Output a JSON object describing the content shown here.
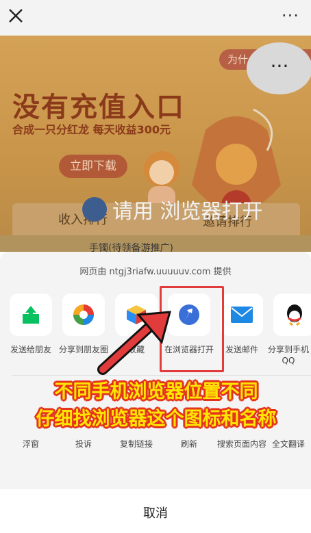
{
  "top_bar": {
    "close_icon": "close-icon",
    "more_icon": "more-icon",
    "more_glyph": "···"
  },
  "background_page": {
    "why_button": "为什么",
    "bubble_dots": "···",
    "title": "没有充值入口",
    "subtitle": "合成一只分红龙 每天收益300元",
    "download_button": "立即下载",
    "open_hint": "请用 浏览器打开",
    "tabs": [
      "收入排行",
      "邀请排行"
    ],
    "row_text": "手镯(待领备游推广)"
  },
  "share_sheet": {
    "provided_by": "网页由 ntgj3riafw.uuuuuv.com 提供",
    "row1": [
      {
        "label": "发送给朋友",
        "icon": "share-arrow-icon",
        "color": "#07c160"
      },
      {
        "label": "分享到朋友圈",
        "icon": "moments-icon",
        "color": "#f5a623"
      },
      {
        "label": "收藏",
        "icon": "favorite-cube-icon",
        "color": "#2a8cf0"
      },
      {
        "label": "在浏览器打开",
        "icon": "browser-icon",
        "color": "#3a6fd8"
      },
      {
        "label": "发送邮件",
        "icon": "mail-icon",
        "color": "#1e88e5"
      },
      {
        "label": "分享到手机QQ",
        "icon": "qq-icon",
        "color": "#111111"
      }
    ],
    "row2": [
      "浮窗",
      "投诉",
      "复制链接",
      "刷新",
      "搜索页面内容",
      "全文翻译"
    ],
    "cancel": "取消"
  },
  "annotation": {
    "line1": "不同手机浏览器位置不同",
    "line2": "仔细找浏览器这个图标和名称",
    "highlight_color": "#e23b3b"
  }
}
